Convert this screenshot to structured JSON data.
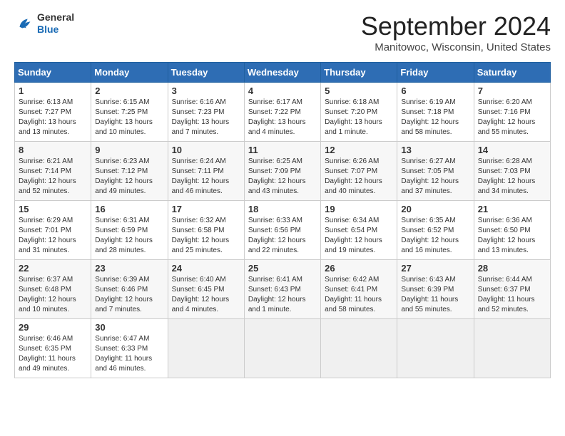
{
  "logo": {
    "line1": "General",
    "line2": "Blue"
  },
  "title": "September 2024",
  "location": "Manitowoc, Wisconsin, United States",
  "days_of_week": [
    "Sunday",
    "Monday",
    "Tuesday",
    "Wednesday",
    "Thursday",
    "Friday",
    "Saturday"
  ],
  "weeks": [
    [
      {
        "day": "1",
        "sunrise": "6:13 AM",
        "sunset": "7:27 PM",
        "daylight": "13 hours and 13 minutes."
      },
      {
        "day": "2",
        "sunrise": "6:15 AM",
        "sunset": "7:25 PM",
        "daylight": "13 hours and 10 minutes."
      },
      {
        "day": "3",
        "sunrise": "6:16 AM",
        "sunset": "7:23 PM",
        "daylight": "13 hours and 7 minutes."
      },
      {
        "day": "4",
        "sunrise": "6:17 AM",
        "sunset": "7:22 PM",
        "daylight": "13 hours and 4 minutes."
      },
      {
        "day": "5",
        "sunrise": "6:18 AM",
        "sunset": "7:20 PM",
        "daylight": "13 hours and 1 minute."
      },
      {
        "day": "6",
        "sunrise": "6:19 AM",
        "sunset": "7:18 PM",
        "daylight": "12 hours and 58 minutes."
      },
      {
        "day": "7",
        "sunrise": "6:20 AM",
        "sunset": "7:16 PM",
        "daylight": "12 hours and 55 minutes."
      }
    ],
    [
      {
        "day": "8",
        "sunrise": "6:21 AM",
        "sunset": "7:14 PM",
        "daylight": "12 hours and 52 minutes."
      },
      {
        "day": "9",
        "sunrise": "6:23 AM",
        "sunset": "7:12 PM",
        "daylight": "12 hours and 49 minutes."
      },
      {
        "day": "10",
        "sunrise": "6:24 AM",
        "sunset": "7:11 PM",
        "daylight": "12 hours and 46 minutes."
      },
      {
        "day": "11",
        "sunrise": "6:25 AM",
        "sunset": "7:09 PM",
        "daylight": "12 hours and 43 minutes."
      },
      {
        "day": "12",
        "sunrise": "6:26 AM",
        "sunset": "7:07 PM",
        "daylight": "12 hours and 40 minutes."
      },
      {
        "day": "13",
        "sunrise": "6:27 AM",
        "sunset": "7:05 PM",
        "daylight": "12 hours and 37 minutes."
      },
      {
        "day": "14",
        "sunrise": "6:28 AM",
        "sunset": "7:03 PM",
        "daylight": "12 hours and 34 minutes."
      }
    ],
    [
      {
        "day": "15",
        "sunrise": "6:29 AM",
        "sunset": "7:01 PM",
        "daylight": "12 hours and 31 minutes."
      },
      {
        "day": "16",
        "sunrise": "6:31 AM",
        "sunset": "6:59 PM",
        "daylight": "12 hours and 28 minutes."
      },
      {
        "day": "17",
        "sunrise": "6:32 AM",
        "sunset": "6:58 PM",
        "daylight": "12 hours and 25 minutes."
      },
      {
        "day": "18",
        "sunrise": "6:33 AM",
        "sunset": "6:56 PM",
        "daylight": "12 hours and 22 minutes."
      },
      {
        "day": "19",
        "sunrise": "6:34 AM",
        "sunset": "6:54 PM",
        "daylight": "12 hours and 19 minutes."
      },
      {
        "day": "20",
        "sunrise": "6:35 AM",
        "sunset": "6:52 PM",
        "daylight": "12 hours and 16 minutes."
      },
      {
        "day": "21",
        "sunrise": "6:36 AM",
        "sunset": "6:50 PM",
        "daylight": "12 hours and 13 minutes."
      }
    ],
    [
      {
        "day": "22",
        "sunrise": "6:37 AM",
        "sunset": "6:48 PM",
        "daylight": "12 hours and 10 minutes."
      },
      {
        "day": "23",
        "sunrise": "6:39 AM",
        "sunset": "6:46 PM",
        "daylight": "12 hours and 7 minutes."
      },
      {
        "day": "24",
        "sunrise": "6:40 AM",
        "sunset": "6:45 PM",
        "daylight": "12 hours and 4 minutes."
      },
      {
        "day": "25",
        "sunrise": "6:41 AM",
        "sunset": "6:43 PM",
        "daylight": "12 hours and 1 minute."
      },
      {
        "day": "26",
        "sunrise": "6:42 AM",
        "sunset": "6:41 PM",
        "daylight": "11 hours and 58 minutes."
      },
      {
        "day": "27",
        "sunrise": "6:43 AM",
        "sunset": "6:39 PM",
        "daylight": "11 hours and 55 minutes."
      },
      {
        "day": "28",
        "sunrise": "6:44 AM",
        "sunset": "6:37 PM",
        "daylight": "11 hours and 52 minutes."
      }
    ],
    [
      {
        "day": "29",
        "sunrise": "6:46 AM",
        "sunset": "6:35 PM",
        "daylight": "11 hours and 49 minutes."
      },
      {
        "day": "30",
        "sunrise": "6:47 AM",
        "sunset": "6:33 PM",
        "daylight": "11 hours and 46 minutes."
      },
      null,
      null,
      null,
      null,
      null
    ]
  ]
}
